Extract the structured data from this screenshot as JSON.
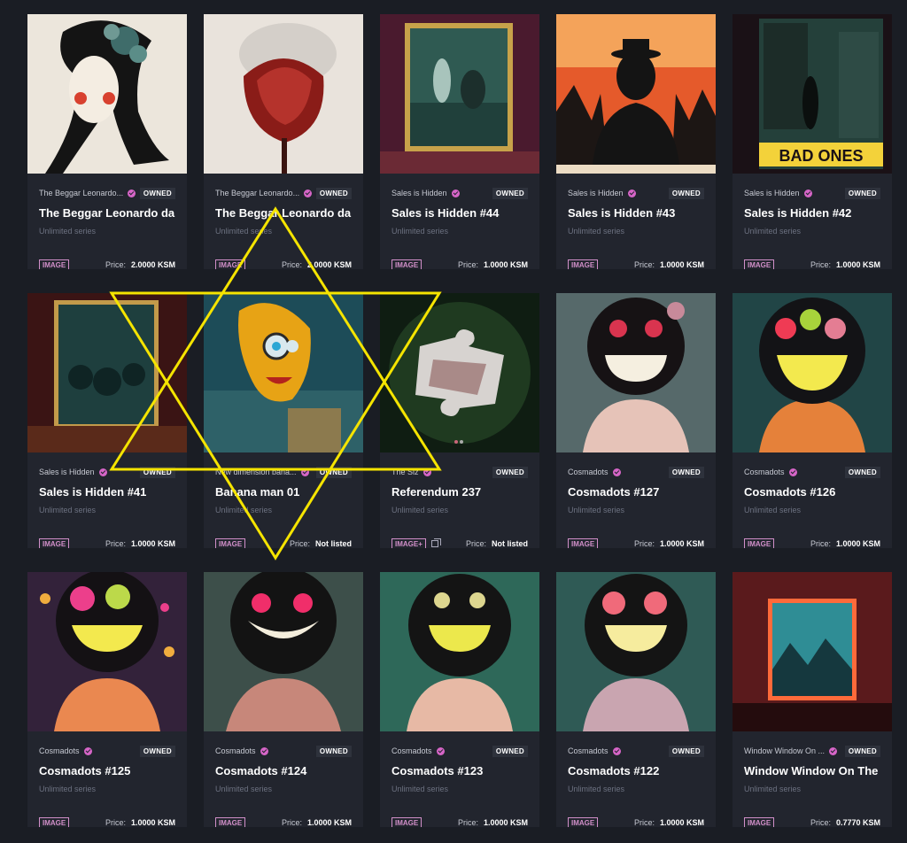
{
  "price_label": "Price:",
  "badges": {
    "image": "IMAGE",
    "image_multi": "IMAGE+"
  },
  "owned_label": "OWNED",
  "cards": [
    {
      "collection": "The Beggar Leonardo...",
      "title": "The Beggar Leonardo da",
      "series": "Unlimited series",
      "price": "2.0000 KSM",
      "owned": true,
      "badge": "IMAGE",
      "art": "beggar-woman"
    },
    {
      "collection": "The Beggar Leonardo...",
      "title": "The Beggar Leonardo da",
      "series": "Unlimited series",
      "price": "2.0000 KSM",
      "owned": true,
      "badge": "IMAGE",
      "art": "smoke-rose"
    },
    {
      "collection": "Sales is Hidden",
      "title": "Sales is Hidden #44",
      "series": "Unlimited series",
      "price": "1.0000 KSM",
      "owned": true,
      "badge": "IMAGE",
      "art": "gallery-scene"
    },
    {
      "collection": "Sales is Hidden",
      "title": "Sales is Hidden #43",
      "series": "Unlimited series",
      "price": "1.0000 KSM",
      "owned": true,
      "badge": "IMAGE",
      "art": "man-in-hat"
    },
    {
      "collection": "Sales is Hidden",
      "title": "Sales is Hidden #42",
      "series": "Unlimited series",
      "price": "1.0000 KSM",
      "owned": true,
      "badge": "IMAGE",
      "art": "bad-ones-poster",
      "poster_text": "BAD ONES"
    },
    {
      "collection": "Sales is Hidden",
      "title": "Sales is Hidden #41",
      "series": "Unlimited series",
      "price": "1.0000 KSM",
      "owned": true,
      "badge": "IMAGE",
      "art": "framed-creatures"
    },
    {
      "collection": "New dimension bana...",
      "title": "Banana man 01",
      "series": "Unlimited series",
      "price": "Not listed",
      "owned": true,
      "badge": "IMAGE",
      "art": "robot-banana"
    },
    {
      "collection": "The Siz",
      "title": "Referendum 237",
      "series": "Unlimited series",
      "price": "Not listed",
      "owned": true,
      "badge": "IMAGE+",
      "multi": true,
      "art": "puzzle-piece"
    },
    {
      "collection": "Cosmadots",
      "title": "Cosmadots #127",
      "series": "Unlimited series",
      "price": "1.0000 KSM",
      "owned": true,
      "badge": "IMAGE",
      "art": "cosmadot-a"
    },
    {
      "collection": "Cosmadots",
      "title": "Cosmadots #126",
      "series": "Unlimited series",
      "price": "1.0000 KSM",
      "owned": true,
      "badge": "IMAGE",
      "art": "cosmadot-b"
    },
    {
      "collection": "Cosmadots",
      "title": "Cosmadots #125",
      "series": "Unlimited series",
      "price": "1.0000 KSM",
      "owned": true,
      "badge": "IMAGE",
      "art": "cosmadot-c"
    },
    {
      "collection": "Cosmadots",
      "title": "Cosmadots #124",
      "series": "Unlimited series",
      "price": "1.0000 KSM",
      "owned": true,
      "badge": "IMAGE",
      "art": "cosmadot-d"
    },
    {
      "collection": "Cosmadots",
      "title": "Cosmadots #123",
      "series": "Unlimited series",
      "price": "1.0000 KSM",
      "owned": true,
      "badge": "IMAGE",
      "art": "cosmadot-e"
    },
    {
      "collection": "Cosmadots",
      "title": "Cosmadots #122",
      "series": "Unlimited series",
      "price": "1.0000 KSM",
      "owned": true,
      "badge": "IMAGE",
      "art": "cosmadot-f"
    },
    {
      "collection": "Window Window On ...",
      "title": "Window Window On The",
      "series": "Unlimited series",
      "price": "0.7770 KSM",
      "owned": true,
      "badge": "IMAGE",
      "art": "neon-window"
    }
  ],
  "overlay": {
    "icon": "six-pointed-star-icon",
    "color": "#f5e400"
  },
  "colors": {
    "background": "#1a1d24",
    "card": "#22252e",
    "accent": "#d665c7"
  }
}
